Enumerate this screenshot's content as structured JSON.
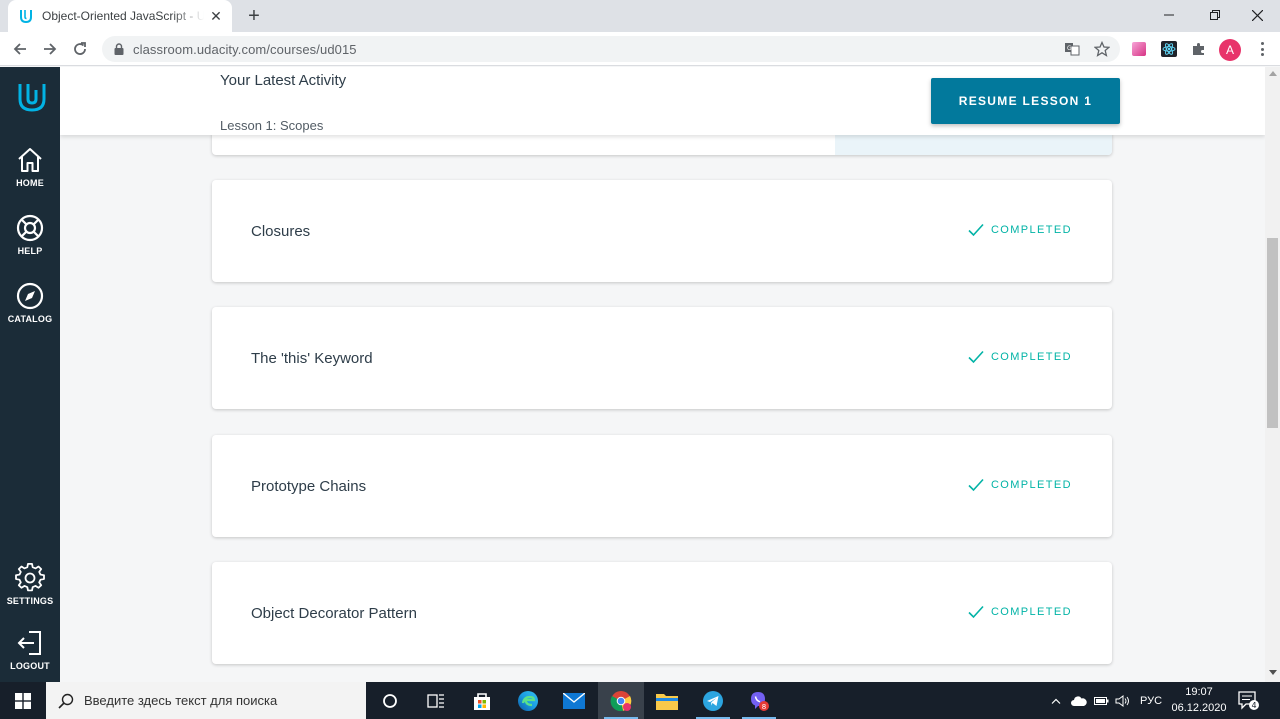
{
  "browser": {
    "tab_title": "Object-Oriented JavaScript - Udacity",
    "tab_close": "✕",
    "new_tab": "+",
    "url": "classroom.udacity.com/courses/ud015",
    "profile_initial": "A",
    "window_controls": {
      "minimize": "—",
      "restore": "❐",
      "close": "✕"
    }
  },
  "sidebar": {
    "items": [
      {
        "label": "HOME",
        "icon": "home-icon"
      },
      {
        "label": "HELP",
        "icon": "lifebuoy-icon"
      },
      {
        "label": "CATALOG",
        "icon": "compass-icon"
      },
      {
        "label": "SETTINGS",
        "icon": "gear-icon"
      },
      {
        "label": "LOGOUT",
        "icon": "logout-icon"
      }
    ]
  },
  "activity": {
    "heading": "Your Latest Activity",
    "lesson": "Lesson 1: Scopes",
    "resume_label": "RESUME LESSON 1"
  },
  "lessons": [
    {
      "title": "Closures",
      "status": "COMPLETED"
    },
    {
      "title": "The 'this' Keyword",
      "status": "COMPLETED"
    },
    {
      "title": "Prototype Chains",
      "status": "COMPLETED"
    },
    {
      "title": "Object Decorator Pattern",
      "status": "COMPLETED"
    }
  ],
  "taskbar": {
    "search_placeholder": "Введите здесь текст для поиска",
    "language": "РУС",
    "time": "19:07",
    "date": "06.12.2020",
    "viber_badge": "8",
    "notification_count": "4"
  },
  "colors": {
    "sidebar_bg": "#1b2c38",
    "accent_teal": "#02b3a6",
    "resume_button": "#02799c",
    "udacity_logo": "#02b3e4"
  }
}
